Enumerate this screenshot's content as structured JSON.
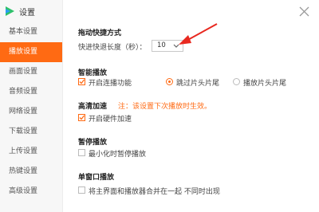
{
  "window": {
    "title": "设置"
  },
  "sidebar": {
    "items": [
      {
        "label": "基本设置"
      },
      {
        "label": "播放设置"
      },
      {
        "label": "画面设置"
      },
      {
        "label": "音频设置"
      },
      {
        "label": "网络设置"
      },
      {
        "label": "下载设置"
      },
      {
        "label": "上传设置"
      },
      {
        "label": "热键设置"
      },
      {
        "label": "高级设置"
      }
    ]
  },
  "drag_fast": {
    "title": "拖动快捷方式",
    "label": "快进快退长度（秒）：",
    "value": "10"
  },
  "smart_play": {
    "title": "智能播放",
    "continuous_label": "开启连播功能",
    "skip_label": "跳过片头片尾",
    "play_label": "播放片头片尾",
    "continuous_checked": true,
    "selected_option": "skip"
  },
  "hd_accel": {
    "title": "高清加速",
    "note": "注：该设置下次播放时生效。",
    "hardware_label": "开启硬件加速",
    "hardware_checked": true
  },
  "pause": {
    "title": "暂停播放",
    "minimize_label": "最小化时暂停播放",
    "minimize_checked": false
  },
  "single_window": {
    "title": "单窗口播放",
    "merge_label": "将主界面和播放器合并在一起 不同时出现",
    "merge_checked": false
  },
  "colors": {
    "accent": "#ff6a13",
    "logo_green": "#2ec16a",
    "logo_blue": "#2a9df4"
  }
}
